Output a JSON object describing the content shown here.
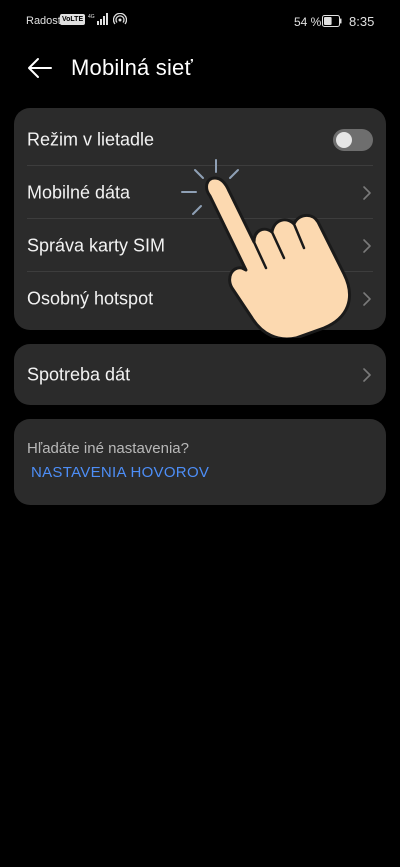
{
  "status_bar": {
    "carrier": "Radost",
    "volte": "VoLTE",
    "network_type": "4G",
    "battery_percent": "54 %",
    "battery_level": 0.54,
    "time": "8:35"
  },
  "header": {
    "title": "Mobilná sieť",
    "back_icon": "arrow-left-icon"
  },
  "network_card": {
    "items": [
      {
        "label": "Režim v lietadle",
        "control": "toggle",
        "toggle_on": false
      },
      {
        "label": "Mobilné dáta",
        "control": "chevron"
      },
      {
        "label": "Správa karty SIM",
        "control": "chevron"
      },
      {
        "label": "Osobný hotspot",
        "control": "chevron"
      }
    ]
  },
  "usage_card": {
    "label": "Spotreba dát",
    "control": "chevron"
  },
  "more_card": {
    "question": "Hľadáte iné nastavenia?",
    "link": "NASTAVENIA HOVOROV"
  },
  "colors": {
    "background": "#000000",
    "card": "#2b2b2b",
    "link": "#4d8ef7",
    "hand_fill": "#fcd9b0"
  },
  "overlay": {
    "icon": "pointing-hand-icon"
  }
}
